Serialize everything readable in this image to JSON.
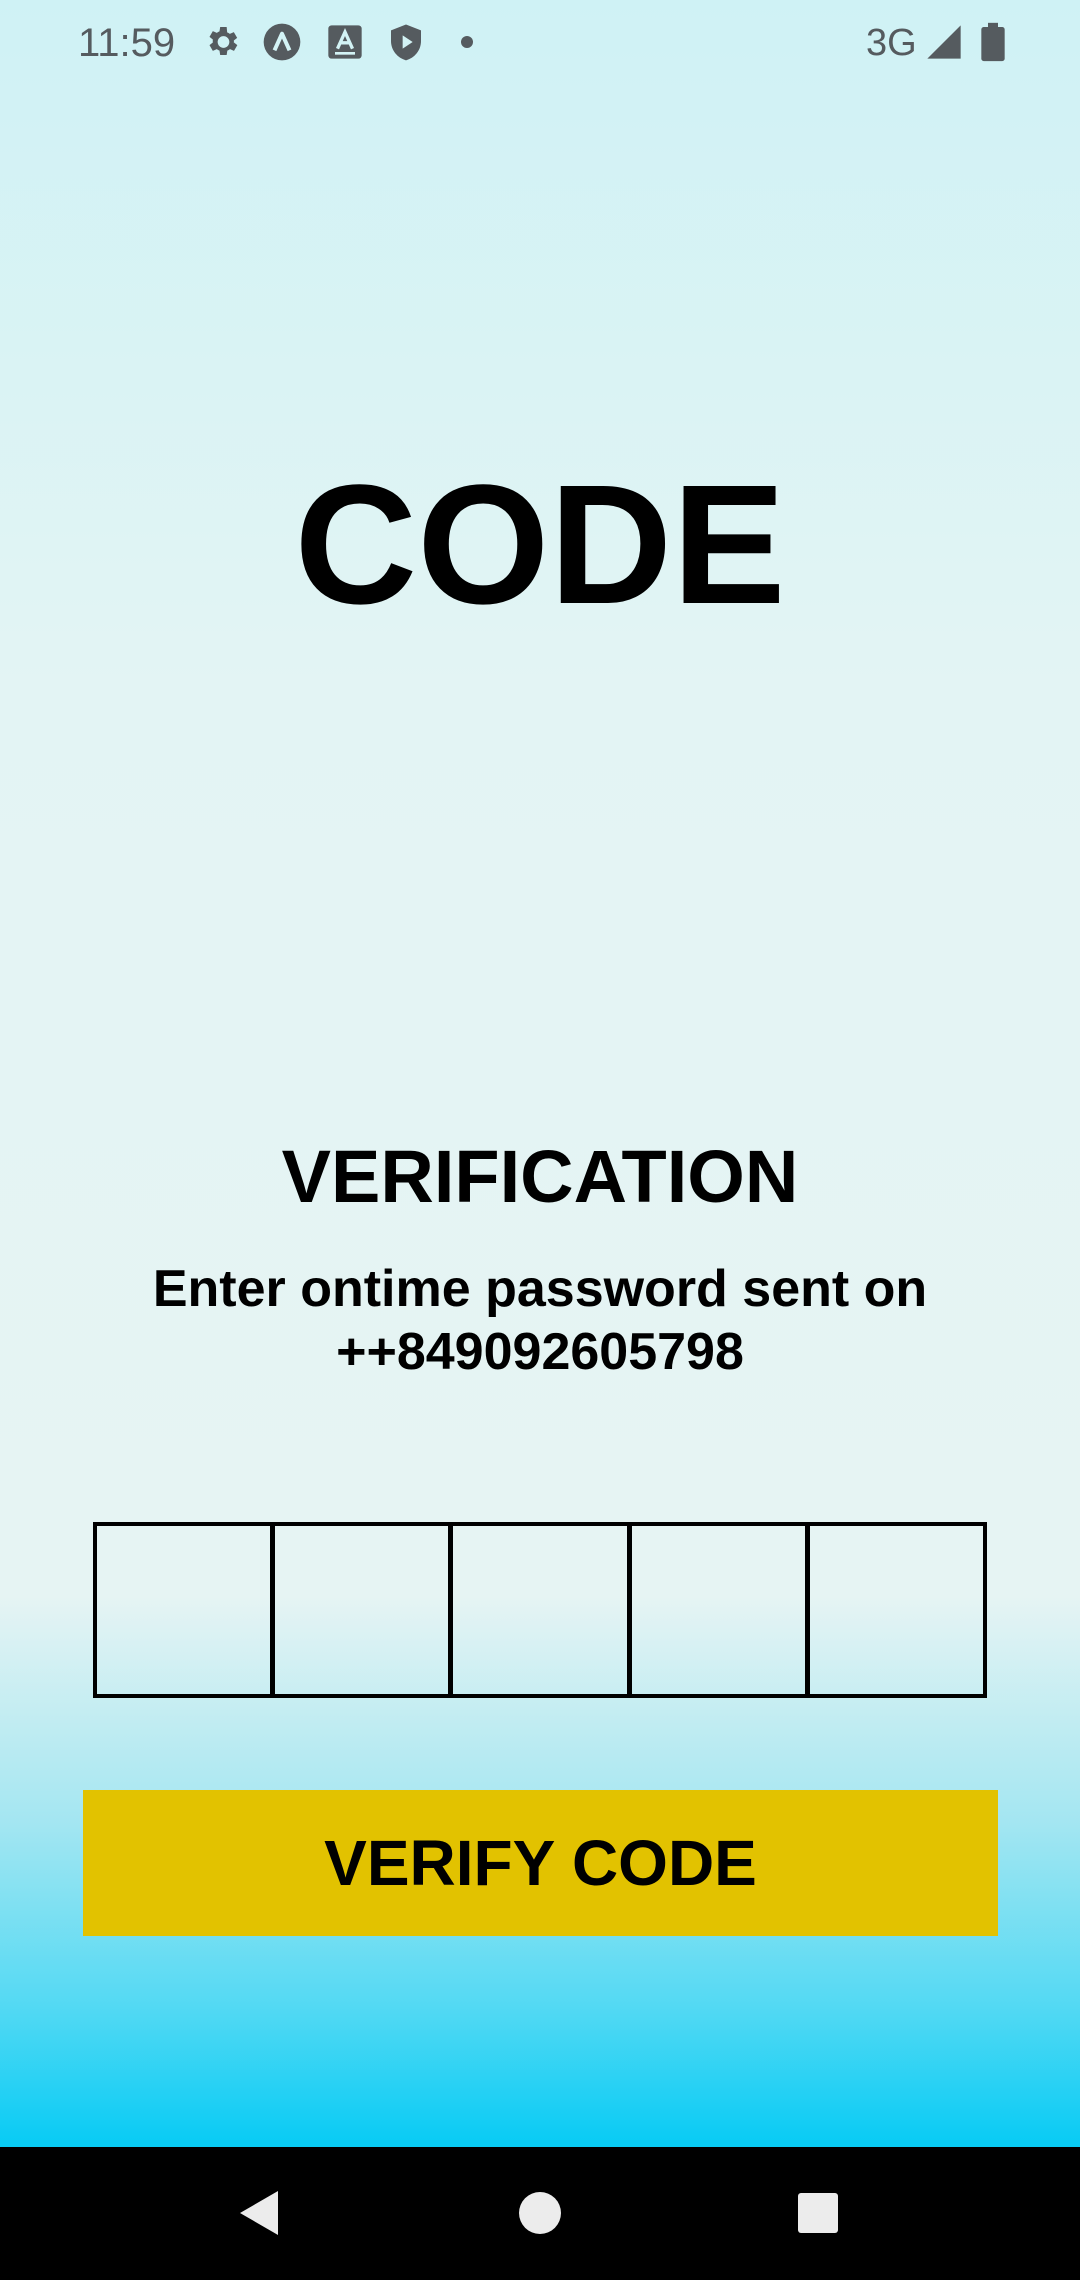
{
  "status_bar": {
    "time": "11:59",
    "network": "3G",
    "icons": [
      "settings-icon",
      "app-a-icon",
      "text-a-icon",
      "shield-play-icon",
      "dot-icon",
      "signal-icon",
      "battery-icon"
    ]
  },
  "screen": {
    "title": "CODE",
    "subtitle": "VERIFICATION",
    "instruction": "Enter ontime password sent on ++849092605798",
    "otp_box_count": 5,
    "verify_button_label": "VERIFY CODE"
  },
  "nav_bar": {
    "buttons": [
      "back-icon",
      "home-icon",
      "recents-icon"
    ]
  },
  "colors": {
    "button": "#e2c200",
    "status_icons": "#555b5f",
    "nav_bar": "#000000"
  }
}
